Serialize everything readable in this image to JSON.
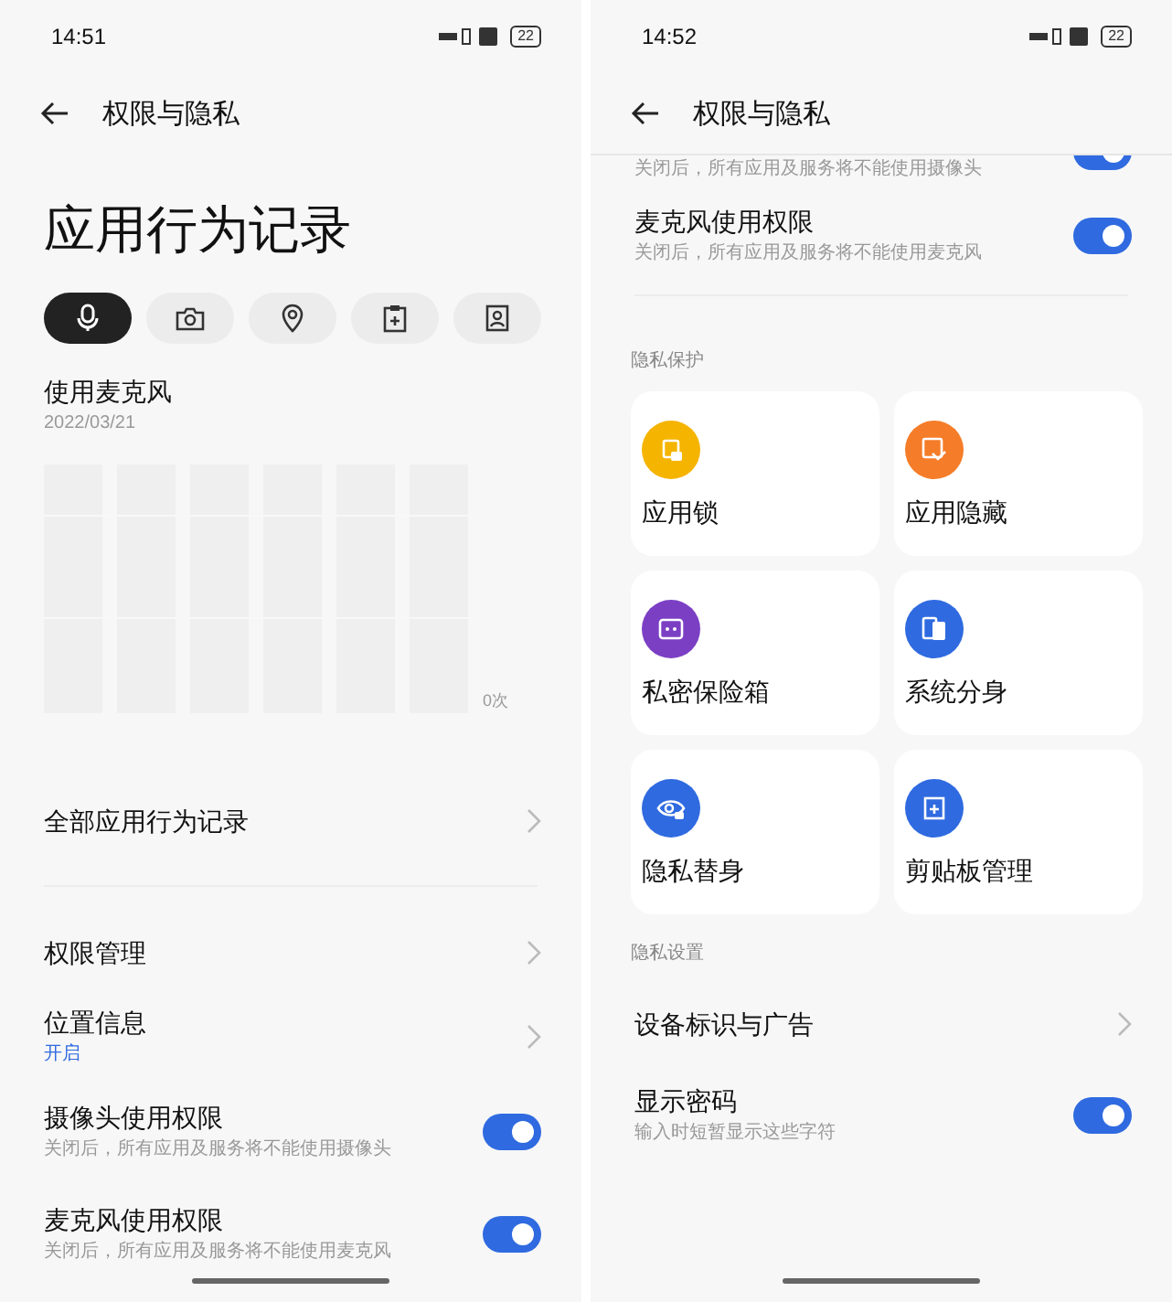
{
  "screens": [
    {
      "status_bar": {
        "time": "14:51",
        "battery": "22"
      },
      "header": {
        "title": "权限与隐私"
      },
      "page_title": "应用行为记录",
      "tabs": [
        {
          "selected": true
        },
        {
          "selected": false
        },
        {
          "selected": false
        },
        {
          "selected": false
        },
        {
          "selected": false
        }
      ],
      "usage": {
        "title": "使用麦克风",
        "date": "2022/03/21",
        "axis_label": "0次"
      },
      "rows": [
        {
          "kind": "link",
          "title": "全部应用行为记录"
        },
        {
          "kind": "divider"
        },
        {
          "kind": "link",
          "title": "权限管理"
        },
        {
          "kind": "link",
          "title": "位置信息",
          "status": "开启"
        },
        {
          "kind": "toggle",
          "title": "摄像头使用权限",
          "subtitle": "关闭后，所有应用及服务将不能使用摄像头",
          "on": true
        },
        {
          "kind": "toggle",
          "title": "麦克风使用权限",
          "subtitle": "关闭后，所有应用及服务将不能使用麦克风",
          "on": true
        }
      ]
    },
    {
      "status_bar": {
        "time": "14:52",
        "battery": "22"
      },
      "header": {
        "title": "权限与隐私"
      },
      "rows": [
        {
          "kind": "partial",
          "subtitle": "关闭后，所有应用及服务将不能使用摄像头",
          "on": true
        },
        {
          "kind": "toggle",
          "title": "麦克风使用权限",
          "subtitle": "关闭后，所有应用及服务将不能使用麦克风",
          "on": true
        },
        {
          "kind": "divider"
        },
        {
          "kind": "section",
          "title": "隐私保护"
        },
        {
          "kind": "cards",
          "items": [
            {
              "label": "应用锁",
              "color": "#f5b400"
            },
            {
              "label": "应用隐藏",
              "color": "#f57c28"
            },
            {
              "label": "私密保险箱",
              "color": "#7b3fc4"
            },
            {
              "label": "系统分身",
              "color": "#2f6ae0"
            },
            {
              "label": "隐私替身",
              "color": "#2f6ae0"
            },
            {
              "label": "剪贴板管理",
              "color": "#2f6ae0"
            }
          ]
        },
        {
          "kind": "section",
          "title": "隐私设置"
        },
        {
          "kind": "link",
          "title": "设备标识与广告"
        },
        {
          "kind": "toggle",
          "title": "显示密码",
          "subtitle": "输入时短暂显示这些字符",
          "on": true
        }
      ]
    }
  ]
}
